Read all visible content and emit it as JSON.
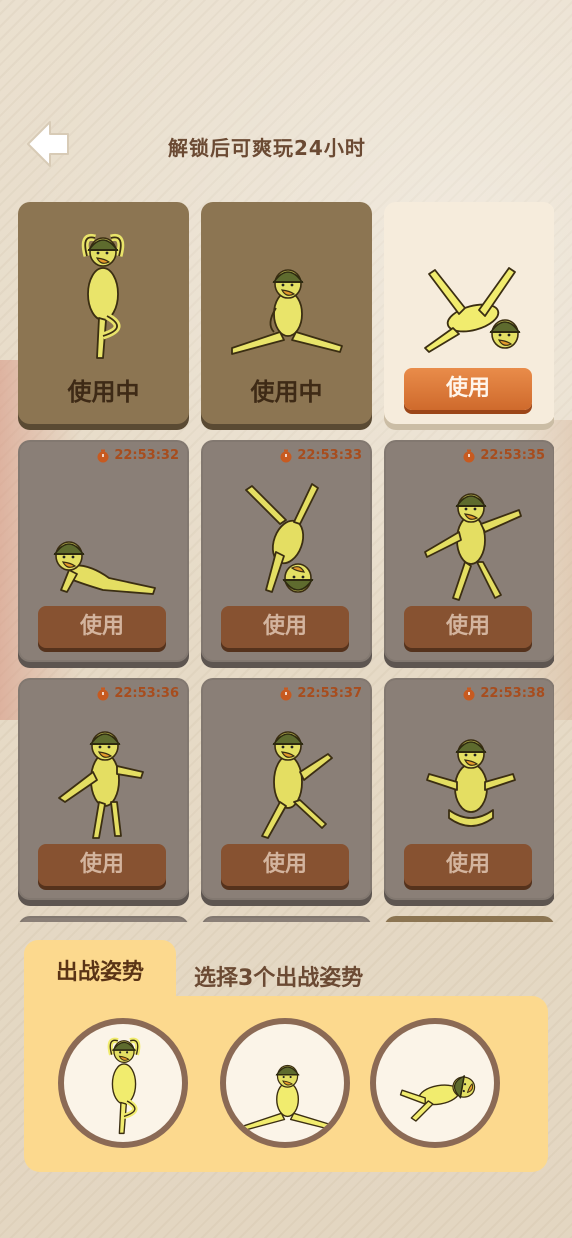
{
  "header": {
    "title": "解锁后可爽玩24小时",
    "back_icon": "back-arrow-icon"
  },
  "cards": [
    {
      "state": "in_use",
      "label": "使用中",
      "pose": "tree-pose"
    },
    {
      "state": "in_use",
      "label": "使用中",
      "pose": "split-pose"
    },
    {
      "state": "available",
      "label": "使用",
      "pose": "lying-kick-pose"
    },
    {
      "state": "locked",
      "label": "使用",
      "timer": "22:53:32",
      "pose": "cobra-pose"
    },
    {
      "state": "locked",
      "label": "使用",
      "timer": "22:53:33",
      "pose": "handstand-pose"
    },
    {
      "state": "locked",
      "label": "使用",
      "timer": "22:53:35",
      "pose": "star-pose"
    },
    {
      "state": "locked",
      "label": "使用",
      "timer": "22:53:36",
      "pose": "wave-pose"
    },
    {
      "state": "locked",
      "label": "使用",
      "timer": "22:53:37",
      "pose": "walk-pose"
    },
    {
      "state": "locked",
      "label": "使用",
      "timer": "22:53:38",
      "pose": "shrug-pose"
    }
  ],
  "battle": {
    "tab_label": "出战姿势",
    "hint": "选择3个出战姿势",
    "slots": [
      "tree-pose",
      "split-pose",
      "lying-kick-pose"
    ]
  },
  "colors": {
    "card_locked": "#8a7f77",
    "card_in_use": "#8c7552",
    "card_selected": "#f6ecdc",
    "button_active": "#e07b3a",
    "button_locked": "#875231",
    "panel": "#fcd98e",
    "timer_text": "#a74d1e"
  }
}
